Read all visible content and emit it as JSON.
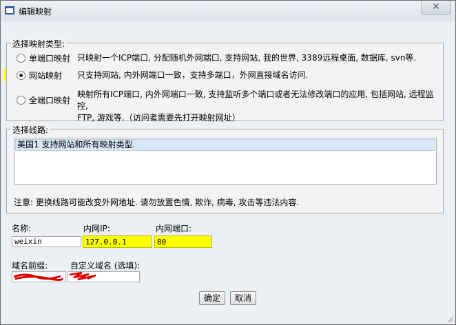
{
  "window": {
    "title": "编辑映射"
  },
  "mapping_type": {
    "legend": "选择映射类型:",
    "options": [
      {
        "label": "单端口映射",
        "desc": "只映射一个ICP端口, 分配随机外网端口, 支持网站, 我的世界, 3389远程桌面, 数据库, svn等.",
        "selected": false
      },
      {
        "label": "网站映射",
        "desc": "只支持网站, 内外网端口一致，支持多端口，外网直接域名访问.",
        "selected": true
      },
      {
        "label": "全端口映射",
        "desc1": "映射所有ICP端口, 内外网端口一致, 支持监听多个端口或者无法修改端口的应用, 包括网站, 远程监控,",
        "desc2": "FTP, 游戏等.（访问者需要先打开映射网址）",
        "selected": false
      }
    ]
  },
  "route": {
    "legend": "选择线路:",
    "items": [
      "美国1 支持网站和所有映射类型."
    ],
    "note": "注意: 更换线路可能改变外网地址. 请勿放置色情, 欺诈, 病毒, 攻击等违法内容."
  },
  "form": {
    "name_label": "名称:",
    "name_value": "weixin",
    "ip_label": "内网IP:",
    "ip_value": "127.0.0.1",
    "port_label": "内网端口:",
    "port_value": "80",
    "prefix_label": "域名前缀:",
    "custom_domain_label": "自定义域名 (选填):"
  },
  "buttons": {
    "ok": "确定",
    "cancel": "取消"
  },
  "colors": {
    "highlight": "#fbff00",
    "scribble": "#e00000"
  }
}
